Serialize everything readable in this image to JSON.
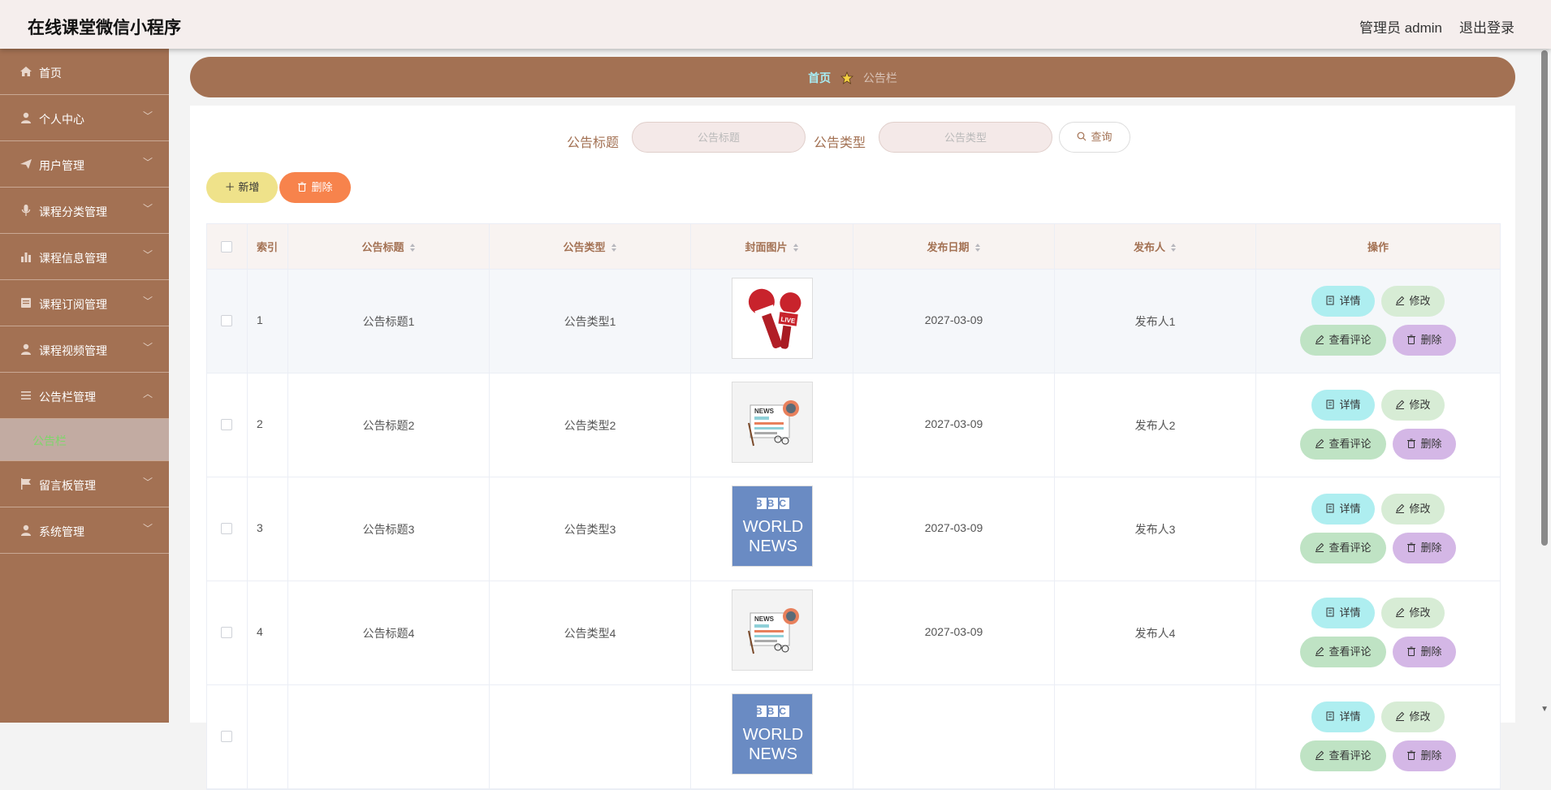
{
  "header": {
    "app_title": "在线课堂微信小程序",
    "admin_label": "管理员 admin",
    "logout_label": "退出登录"
  },
  "sidebar": {
    "items": [
      {
        "label": "首页",
        "icon": "home-icon"
      },
      {
        "label": "个人中心",
        "icon": "user-icon"
      },
      {
        "label": "用户管理",
        "icon": "send-icon"
      },
      {
        "label": "课程分类管理",
        "icon": "microphone-icon"
      },
      {
        "label": "课程信息管理",
        "icon": "bar-chart-icon"
      },
      {
        "label": "课程订阅管理",
        "icon": "document-icon"
      },
      {
        "label": "课程视频管理",
        "icon": "user-icon"
      },
      {
        "label": "公告栏管理",
        "icon": "list-icon"
      },
      {
        "label": "留言板管理",
        "icon": "flag-icon"
      },
      {
        "label": "系统管理",
        "icon": "user-icon"
      }
    ],
    "submenu_active": "公告栏"
  },
  "breadcrumb": {
    "home": "首页",
    "current": "公告栏"
  },
  "search": {
    "title_label": "公告标题",
    "title_placeholder": "公告标题",
    "type_label": "公告类型",
    "type_placeholder": "公告类型",
    "query_label": "查询"
  },
  "actions": {
    "add_label": "新增",
    "delete_label": "删除"
  },
  "table": {
    "headers": [
      "索引",
      "公告标题",
      "公告类型",
      "封面图片",
      "发布日期",
      "发布人",
      "操作"
    ],
    "rows": [
      {
        "index": "1",
        "title": "公告标题1",
        "type": "公告类型1",
        "image": "live-microphones",
        "date": "2027-03-09",
        "publisher": "发布人1"
      },
      {
        "index": "2",
        "title": "公告标题2",
        "type": "公告类型2",
        "image": "newspaper",
        "date": "2027-03-09",
        "publisher": "发布人2"
      },
      {
        "index": "3",
        "title": "公告标题3",
        "type": "公告类型3",
        "image": "bbc-world-news",
        "date": "2027-03-09",
        "publisher": "发布人3"
      },
      {
        "index": "4",
        "title": "公告标题4",
        "type": "公告类型4",
        "image": "newspaper",
        "date": "2027-03-09",
        "publisher": "发布人4"
      },
      {
        "index": "",
        "title": "",
        "type": "",
        "image": "bbc-world-news",
        "date": "",
        "publisher": ""
      }
    ],
    "row_actions": {
      "detail": "详情",
      "edit": "修改",
      "comments": "查看评论",
      "delete": "删除"
    }
  },
  "images": {
    "bbc_line1": "BBC",
    "bbc_line2": "WORLD",
    "bbc_line3": "NEWS",
    "news_label": "NEWS",
    "live_label": "LIVE"
  },
  "colors": {
    "primary": "#a37153",
    "header_bg": "#f5eeed",
    "add_button": "#efe28a",
    "delete_button": "#f7834c",
    "detail_button": "#aeeef0",
    "edit_button": "#d7ecd5",
    "comment_button": "#bfe3c4",
    "row_delete_button": "#d4b7e6",
    "active_submenu_text": "#7ed66a"
  }
}
